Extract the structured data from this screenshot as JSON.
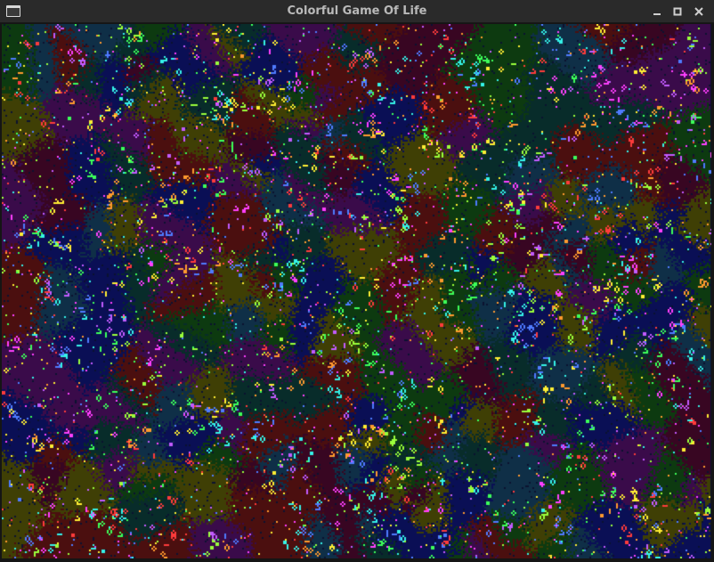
{
  "window": {
    "title": "Colorful Game Of Life",
    "buttons": {
      "minimize_icon": "minimize-icon",
      "maximize_icon": "maximize-icon",
      "close_icon": "close-icon"
    }
  },
  "board": {
    "background": "#0b1230",
    "territory_colors": [
      "#4b0f0f",
      "#082c2a",
      "#0a0f55",
      "#3a0b4a",
      "#3f3f05",
      "#0d3a10",
      "#380622",
      "#0f2f47"
    ],
    "live_cell_colors": [
      "#ff3b3b",
      "#35f2e8",
      "#ff40ff",
      "#ffee33",
      "#3dff5a",
      "#4f7bff",
      "#ff9a2e",
      "#c25bff",
      "#9aff3b"
    ]
  }
}
